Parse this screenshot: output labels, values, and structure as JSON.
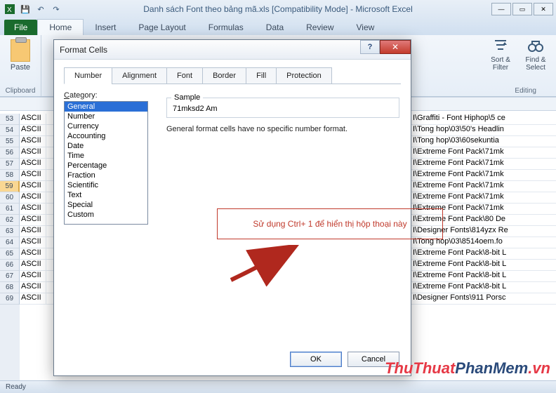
{
  "window": {
    "title": "Danh sách Font theo bảng mã.xls  [Compatibility Mode] - Microsoft Excel"
  },
  "qat": {
    "save": "💾",
    "undo": "↶",
    "redo": "↷"
  },
  "ribbon": {
    "file": "File",
    "tabs": [
      "Home",
      "Insert",
      "Page Layout",
      "Formulas",
      "Data",
      "Review",
      "View"
    ],
    "active": "Home",
    "paste": "Paste",
    "clipboard_group": "Clipboard",
    "sort_filter": "Sort & Filter",
    "find_select": "Find & Select",
    "editing_group": "Editing"
  },
  "rows": {
    "start": 53,
    "selected": 59,
    "labels": [
      "53",
      "54",
      "55",
      "56",
      "57",
      "58",
      "59",
      "60",
      "61",
      "62",
      "63",
      "64",
      "65",
      "66",
      "67",
      "68",
      "69"
    ]
  },
  "colA": "ASCII",
  "right_cells": [
    "I\\Graffiti - Font Hiphop\\5 ce",
    "I\\Tong hop\\03\\50's Headlin",
    "I\\Tong hop\\03\\60sekuntia",
    "I\\Extreme Font Pack\\71mk",
    "I\\Extreme Font Pack\\71mk",
    "I\\Extreme Font Pack\\71mk",
    "I\\Extreme Font Pack\\71mk",
    "I\\Extreme Font Pack\\71mk",
    "I\\Extreme Font Pack\\71mk",
    "I\\Extreme Font Pack\\80 De",
    "I\\Designer Fonts\\814yzx Re",
    "I\\Tong hop\\03\\8514oem.fo",
    "I\\Extreme Font Pack\\8-bit L",
    "I\\Extreme Font Pack\\8-bit L",
    "I\\Extreme Font Pack\\8-bit L",
    "I\\Extreme Font Pack\\8-bit L",
    "I\\Designer Fonts\\911 Porsc"
  ],
  "dialog": {
    "title": "Format Cells",
    "tabs": [
      "Number",
      "Alignment",
      "Font",
      "Border",
      "Fill",
      "Protection"
    ],
    "active_tab": "Number",
    "category_label": "Category:",
    "categories": [
      "General",
      "Number",
      "Currency",
      "Accounting",
      "Date",
      "Time",
      "Percentage",
      "Fraction",
      "Scientific",
      "Text",
      "Special",
      "Custom"
    ],
    "selected_category": "General",
    "sample_label": "Sample",
    "sample_value": "71mksd2 Am",
    "description": "General format cells have no specific number format.",
    "annotation": "Sử dụng Ctrl+ 1 để hiển thị hộp thoại này",
    "ok": "OK",
    "cancel": "Cancel",
    "help": "?",
    "close": "✕"
  },
  "statusbar": {
    "ready": "Ready"
  },
  "watermark": {
    "a": "ThuThuat",
    "b": "PhanMem",
    "c": ".vn"
  }
}
